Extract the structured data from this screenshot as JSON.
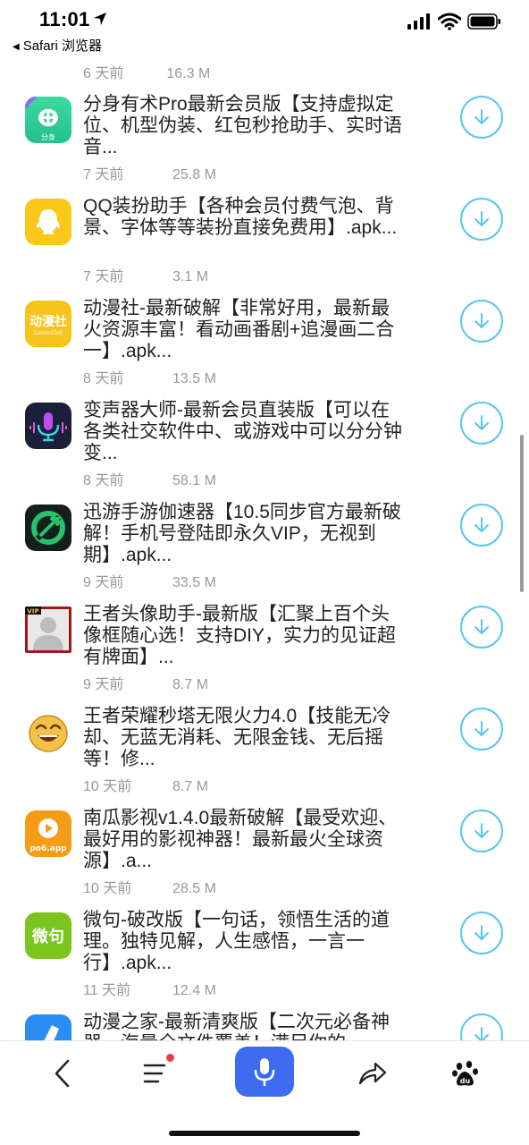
{
  "status_bar": {
    "time": "11:01",
    "back_label": "Safari 浏览器"
  },
  "top_partial": {
    "date": "6 天前",
    "size": "16.3 M"
  },
  "items": [
    {
      "title": "分身有术Pro最新会员版【支持虚拟定位、机型伪装、红包秒抢助手、实时语音...",
      "date": "7 天前",
      "size": "25.8 M",
      "icon": "fenshen-app-icon",
      "icon_text": "分身"
    },
    {
      "title": "QQ装扮助手【各种会员付费气泡、背景、字体等等装扮直接免费用】.apk...",
      "date": "7 天前",
      "size": "3.1 M",
      "icon": "qq-penguin-app-icon",
      "icon_text": ""
    },
    {
      "title": "动漫社-最新破解【非常好用，最新最火资源丰富！看动画番剧+追漫画二合一】.apk...",
      "date": "8 天前",
      "size": "13.5 M",
      "icon": "dongmanshe-app-icon",
      "icon_text": "动漫社"
    },
    {
      "title": "变声器大师-最新会员直装版【可以在各类社交软件中、或游戏中可以分分钟变...",
      "date": "8 天前",
      "size": "58.1 M",
      "icon": "voice-changer-app-icon",
      "icon_text": ""
    },
    {
      "title": "迅游手游伽速器【10.5同步官方最新破解！手机号登陆即永久VIP，无视到期】.apk...",
      "date": "9 天前",
      "size": "33.5 M",
      "icon": "xunyou-app-icon",
      "icon_text": ""
    },
    {
      "title": "王者头像助手-最新版【汇聚上百个头像框随心选！支持DIY，实力的见证超有牌面】...",
      "date": "9 天前",
      "size": "8.7 M",
      "icon": "avatar-app-icon",
      "icon_text": "VIP"
    },
    {
      "title": "王者荣耀秒塔无限火力4.0【技能无冷却、无蓝无消耗、无限金钱、无后摇等！修...",
      "date": "10 天前",
      "size": "8.7 M",
      "icon": "laughing-emoji-app-icon",
      "icon_text": ""
    },
    {
      "title": "南瓜影视v1.4.0最新破解【最受欢迎、最好用的影视神器！最新最火全球资源】.a...",
      "date": "10 天前",
      "size": "28.5 M",
      "icon": "nangua-app-icon",
      "icon_text": "po6.app"
    },
    {
      "title": "微句-破改版【一句话，领悟生活的道理。独特见解，人生感悟，一言一行】.apk...",
      "date": "11 天前",
      "size": "12.4 M",
      "icon": "weiju-app-icon",
      "icon_text": "微句"
    },
    {
      "title": "动漫之家-最新清爽版【二次元必备神器，海量全文件覆盖！满足你的...",
      "date": "",
      "size": "",
      "icon": "dongmanzhijia-app-icon",
      "icon_text": ""
    }
  ],
  "colors": {
    "accent": "#5ac6ec",
    "voice_button": "#3d6cf0",
    "meta_text": "#999999",
    "badge": "#f0394b"
  }
}
